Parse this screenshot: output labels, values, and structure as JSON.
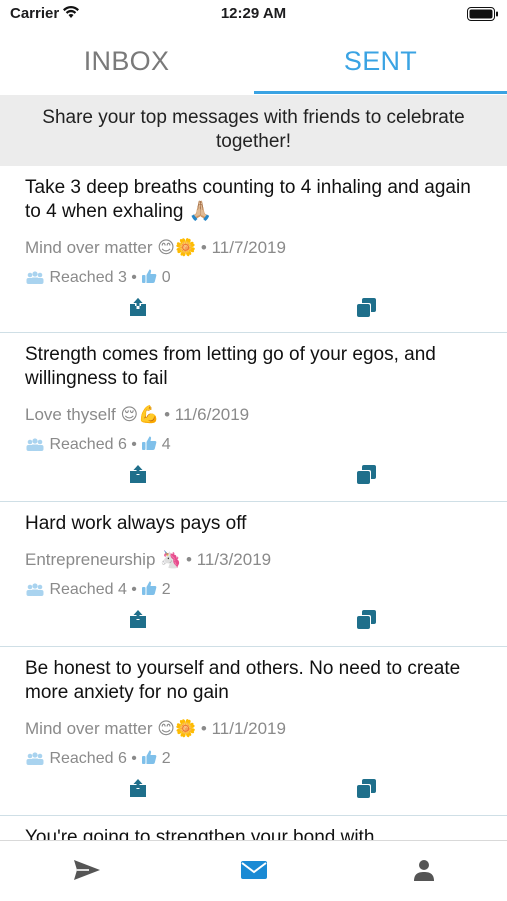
{
  "status_bar": {
    "carrier": "Carrier",
    "time": "12:29 AM"
  },
  "tabs": [
    {
      "label": "INBOX",
      "selected": false
    },
    {
      "label": "SENT",
      "selected": true
    }
  ],
  "banner": {
    "text": "Share your top messages with friends to celebrate together!"
  },
  "colors": {
    "accent": "#3aa3e3",
    "icon_teal": "#1f6f8b",
    "muted": "#8a8a8a"
  },
  "messages": [
    {
      "text": "Take 3 deep breaths counting to 4 inhaling and again to 4 when exhaling 🙏🏼",
      "category": "Mind over matter 😊🌼",
      "date": "11/7/2019",
      "reached_label": "Reached 3",
      "likes": "0"
    },
    {
      "text": "Strength comes from letting go of your egos, and willingness to fail",
      "category": "Love thyself 😌💪",
      "date": "11/6/2019",
      "reached_label": "Reached 6",
      "likes": "4"
    },
    {
      "text": "Hard work always pays off",
      "category": "Entrepreneurship 🦄",
      "date": "11/3/2019",
      "reached_label": "Reached 4",
      "likes": "2"
    },
    {
      "text": "Be honest to yourself and others. No need to create more anxiety for no gain",
      "category": "Mind over matter 😊🌼",
      "date": "11/1/2019",
      "reached_label": "Reached 6",
      "likes": "2"
    }
  ],
  "partial_message": {
    "text": "You're going to strengthen your bond with"
  },
  "bottom_nav": [
    {
      "icon": "send-icon",
      "selected": false
    },
    {
      "icon": "mail-icon",
      "selected": true
    },
    {
      "icon": "person-icon",
      "selected": false
    }
  ]
}
